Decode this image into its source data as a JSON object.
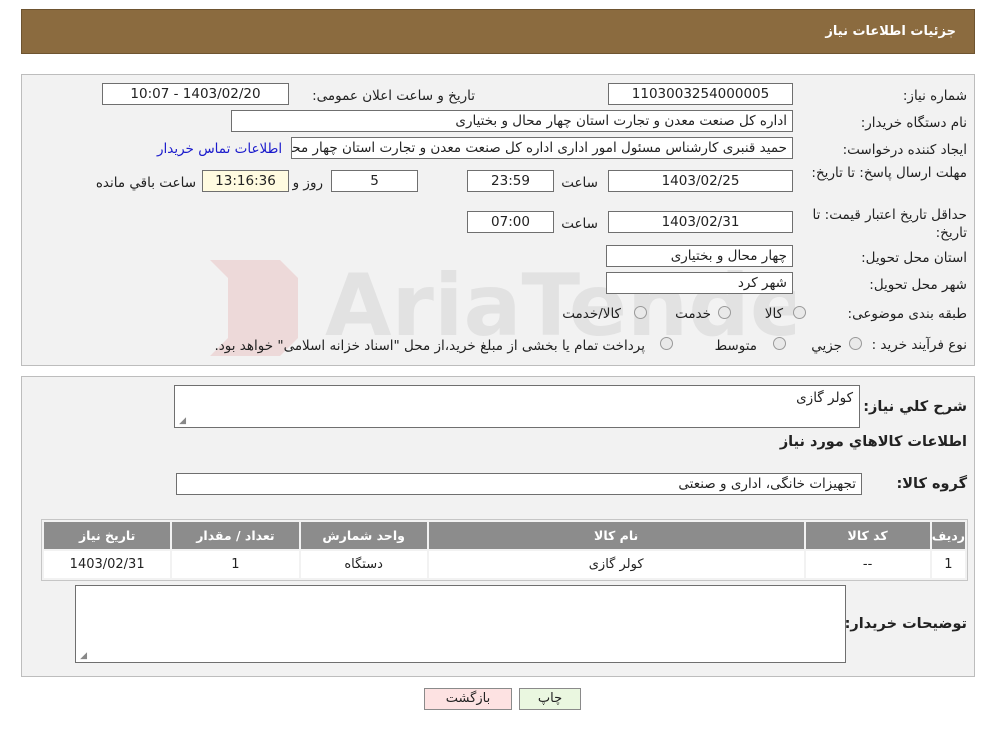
{
  "header": {
    "title": "جزئیات اطلاعات نیاز"
  },
  "watermark": {
    "text": "AriaTender.neT"
  },
  "details": {
    "need_number_label": "شماره نیاز:",
    "need_number": "1103003254000005",
    "announce_label": "تاریخ و ساعت اعلان عمومی:",
    "announce_value": "1403/02/20 - 10:07",
    "buyer_label": "نام دستگاه خریدار:",
    "buyer_value": "اداره کل صنعت  معدن و تجارت استان چهار محال و بختیاری",
    "creator_label": "ایجاد کننده درخواست:",
    "creator_value": "حمید قنبری کارشناس مسئول امور اداری اداره کل صنعت  معدن و تجارت استان چهار محال و بختیاری",
    "contact_link": "اطلاعات تماس خریدار",
    "deadline_label": "مهلت ارسال پاسخ: تا تاریخ:",
    "deadline_date": "1403/02/25",
    "time_label": "ساعت",
    "deadline_time": "23:59",
    "days_value": "5",
    "days_label": "روز و",
    "remaining_time": "13:16:36",
    "remaining_label": "ساعت باقي مانده",
    "validity_label": "حداقل تاریخ اعتبار قیمت: تا تاریخ:",
    "validity_date": "1403/02/31",
    "validity_time": "07:00",
    "province_label": "استان محل تحویل:",
    "province_value": "چهار محال و بختیاری",
    "city_label": "شهر محل تحویل:",
    "city_value": "شهر کرد",
    "category_label": "طبقه بندی موضوعی:",
    "category_options": [
      "كالا",
      "خدمت",
      "کالا/خدمت"
    ],
    "process_label": "نوع فرآیند خرید :",
    "process_options": [
      "جزيي",
      "متوسط"
    ],
    "process_note": "پرداخت تمام یا بخشی از مبلغ خرید،از محل \"اسناد خزانه اسلامی\" خواهد بود."
  },
  "summary": {
    "desc_label": "شرح كلي نياز:",
    "desc_value": "کولر گازی",
    "goods_info_title": "اطلاعات كالاهاي مورد نياز",
    "group_label": "گروه كالا:",
    "group_value": "تجهیزات خانگی، اداری و صنعتی",
    "table": {
      "headers": [
        "رديف",
        "كد كالا",
        "نام كالا",
        "واحد شمارش",
        "تعداد / مقدار",
        "تاريخ نياز"
      ],
      "rows": [
        [
          "1",
          "--",
          "کولر گازی",
          "دستگاه",
          "1",
          "1403/02/31"
        ]
      ]
    },
    "buyer_notes_label": "توضيحات خريدار:",
    "buyer_notes_value": ""
  },
  "buttons": {
    "print": "چاپ",
    "back": "بازگشت"
  },
  "colors": {
    "header": "#8b6b3f",
    "table_header": "#8c8c8c",
    "back_button": "#fde2e2",
    "print_button": "#eaf7e0"
  }
}
